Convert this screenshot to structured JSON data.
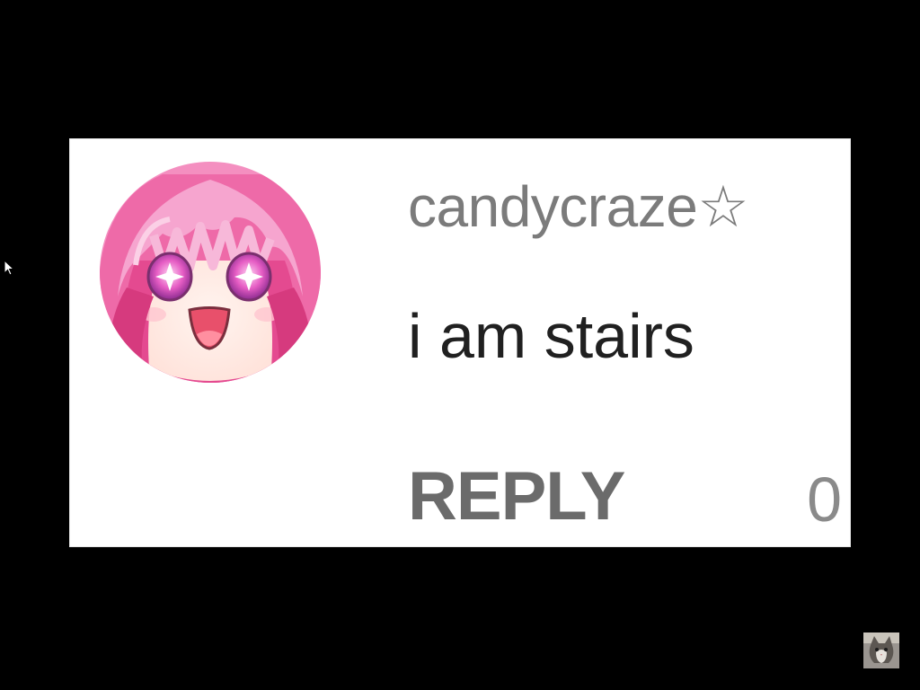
{
  "comment": {
    "username": "candycraze☆",
    "text": "i am stairs",
    "reply_label": "REPLY",
    "like_count": "0",
    "avatar": "anime-girl-avatar"
  },
  "overlay": {
    "cursor_icon": "mouse-pointer-icon",
    "thumbnail": "cat-thumbnail"
  },
  "colors": {
    "background": "#000000",
    "card": "#ffffff",
    "username": "#7b7b7b",
    "text": "#202020",
    "reply": "#6b6b6b",
    "avatar_hair": "#e8559a"
  }
}
